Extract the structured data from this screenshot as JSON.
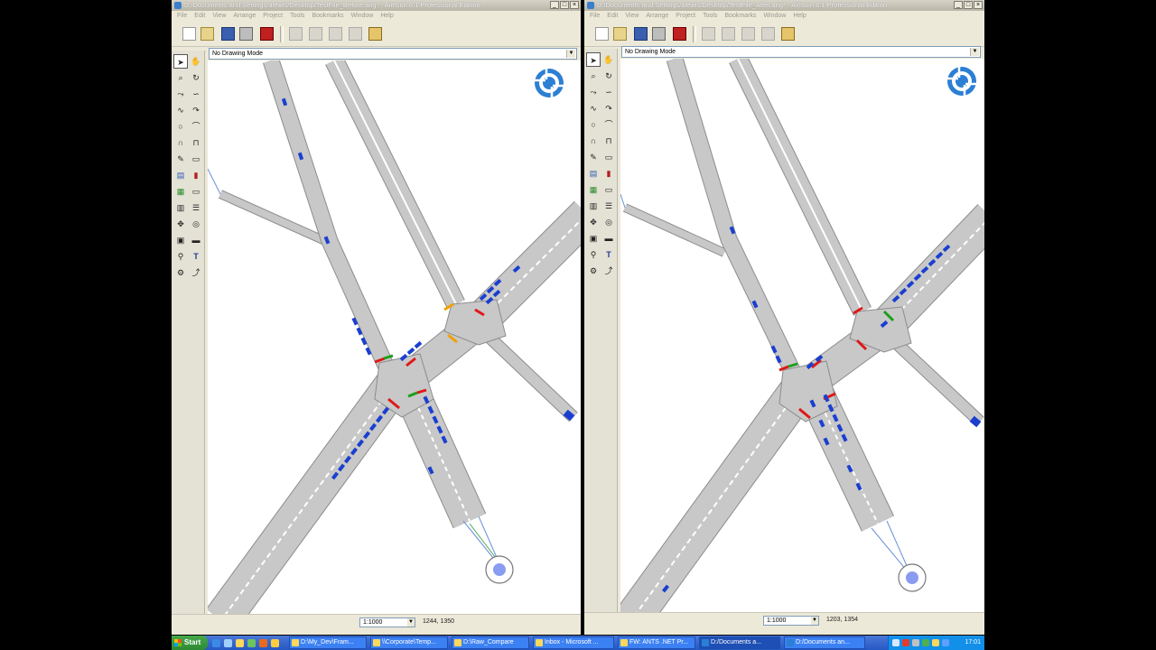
{
  "left_window": {
    "title": "D:/Documents and Settings/alewis/Desktop/TestFile_Before.ang* - Aimsun 6.1 Professional Edition",
    "menus": [
      "File",
      "Edit",
      "View",
      "Arrange",
      "Project",
      "Tools",
      "Bookmarks",
      "Window",
      "Help"
    ],
    "drawing_mode": "No Drawing Mode",
    "scale": "1:1000",
    "coords": "1244, 1350"
  },
  "right_window": {
    "title": "D:/Documents and Settings/alewis/Desktop/TestFile_After.ang* - Aimsun 6.1 Professional Edition",
    "menus": [
      "File",
      "Edit",
      "View",
      "Arrange",
      "Project",
      "Tools",
      "Bookmarks",
      "Window",
      "Help"
    ],
    "drawing_mode": "No Drawing Mode",
    "scale": "1:1000",
    "coords": "1203, 1354"
  },
  "taskbar": {
    "start_label": "Start",
    "tasks": [
      "D:\\My_Dev\\Fram...",
      "\\\\Corporate\\Temp...",
      "D:\\Raw_Compare",
      "Inbox - Microsoft ...",
      "FW: ANTS .NET Pr...",
      "D:/Documents a...",
      "D:/Documents an..."
    ],
    "clock": "17:01"
  },
  "colors": {
    "road": "#c8c8c8",
    "road_edge": "#8c8c8c",
    "vehicle": "#1a3fd0",
    "signal_red": "#e01818",
    "signal_green": "#19a019",
    "signal_amber": "#f0a000",
    "logo": "#2b7fd4"
  }
}
